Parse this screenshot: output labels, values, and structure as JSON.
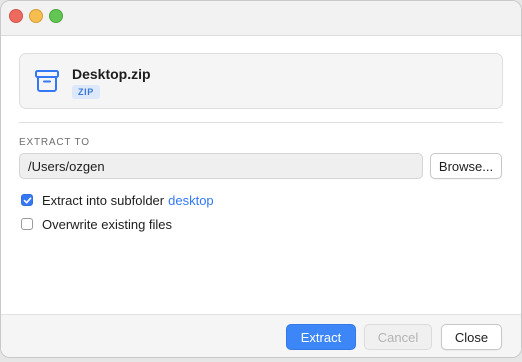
{
  "window": {
    "controls": [
      "close",
      "minimize",
      "zoom"
    ]
  },
  "file": {
    "name": "Desktop.zip",
    "type_badge": "ZIP",
    "icon": "archive-box-icon"
  },
  "extract": {
    "section_label": "EXTRACT TO",
    "path_value": "/Users/ozgen",
    "browse_label": "Browse..."
  },
  "options": {
    "subfolder": {
      "label": "Extract into subfolder",
      "folder_name": "desktop",
      "checked": true
    },
    "overwrite": {
      "label": "Overwrite existing files",
      "checked": false
    }
  },
  "footer": {
    "extract_label": "Extract",
    "cancel_label": "Cancel",
    "close_label": "Close"
  },
  "colors": {
    "accent": "#3478f6",
    "badge_bg": "#dde9fb",
    "traffic_red": "#ee6a5f",
    "traffic_yellow": "#f5be4f",
    "traffic_green": "#62c655"
  }
}
